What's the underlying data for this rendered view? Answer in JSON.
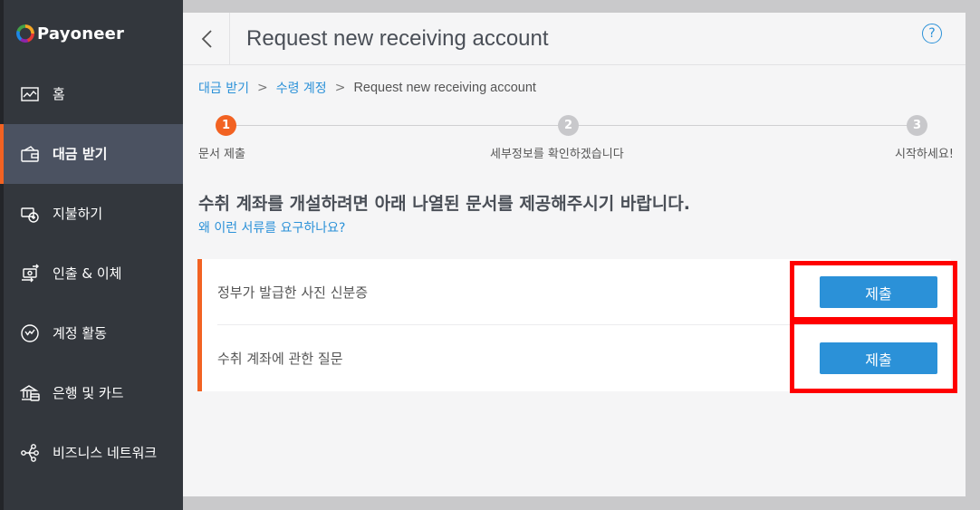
{
  "brand": {
    "name": "Payoneer"
  },
  "sidebar": {
    "items": [
      {
        "label": "홈",
        "icon": "chart-icon",
        "active": false
      },
      {
        "label": "대금 받기",
        "icon": "wallet-icon",
        "active": true
      },
      {
        "label": "지불하기",
        "icon": "pay-icon",
        "active": false
      },
      {
        "label": "인출 & 이체",
        "icon": "transfer-icon",
        "active": false
      },
      {
        "label": "계정 활동",
        "icon": "activity-icon",
        "active": false
      },
      {
        "label": "은행 및 카드",
        "icon": "bank-icon",
        "active": false
      },
      {
        "label": "비즈니스 네트워크",
        "icon": "network-icon",
        "active": false
      }
    ]
  },
  "header": {
    "title": "Request new receiving account",
    "help_icon": "question-icon",
    "help_text": "?"
  },
  "breadcrumb": {
    "first": "대금 받기",
    "second": "수령 계정",
    "current": "Request new receiving account",
    "separator": ">"
  },
  "stepper": {
    "steps": [
      {
        "number": "1",
        "label": "문서 제출",
        "state": "active"
      },
      {
        "number": "2",
        "label": "세부정보를 확인하겠습니다",
        "state": "inactive"
      },
      {
        "number": "3",
        "label": "시작하세요!",
        "state": "inactive"
      }
    ]
  },
  "content": {
    "heading": "수취 계좌를 개설하려면 아래 나열된 문서를 제공해주시기 바랍니다.",
    "why_link": "왜 이런 서류를 요구하나요?",
    "documents": [
      {
        "label": "정부가 발급한 사진 신분증",
        "button": "제출"
      },
      {
        "label": "수취 계좌에 관한 질문",
        "button": "제출"
      }
    ]
  },
  "colors": {
    "accent": "#f26222",
    "link": "#2b91d8",
    "button": "#2b91d8",
    "sidebar": "#33373d",
    "highlight": "#ff0000"
  }
}
